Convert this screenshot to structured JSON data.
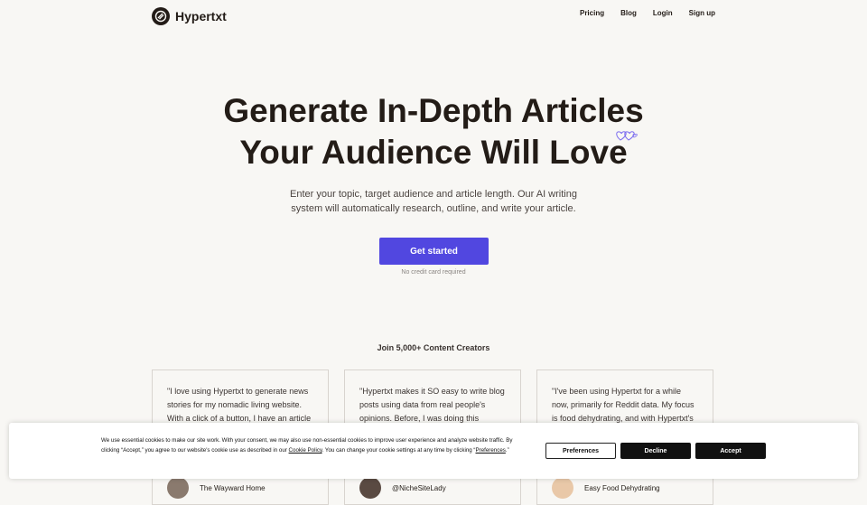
{
  "brand": {
    "name": "Hypertxt"
  },
  "nav": {
    "items": [
      {
        "label": "Pricing"
      },
      {
        "label": "Blog"
      },
      {
        "label": "Login"
      },
      {
        "label": "Sign up"
      }
    ]
  },
  "hero": {
    "title_line1": "Generate In-Depth Articles",
    "title_line2": "Your Audience Will Love",
    "subtitle": "Enter your topic, target audience and article length. Our AI writing system will automatically research, outline, and write your article.",
    "cta_label": "Get started",
    "cta_note": "No credit card required"
  },
  "social": {
    "heading": "Join 5,000+ Content Creators",
    "testimonials": [
      {
        "quote": "\"I love using Hypertxt to generate news stories for my nomadic living website. With a click of a button, I have an article to",
        "author": "The Wayward Home"
      },
      {
        "quote": "\"Hypertxt makes it SO easy to write blog posts using data from real people's opinions. Before, I was doing this manually,",
        "author": "@NicheSiteLady"
      },
      {
        "quote": "\"I've been using Hypertxt for a while now, primarily for Reddit data. My focus is food dehydrating, and with Hypertxt's ability to",
        "author": "Easy Food Dehydrating"
      }
    ]
  },
  "cookie": {
    "text_before_link": "We use essential cookies to make our site work. With your consent, we may also use non-essential cookies to improve user experience and analyze website traffic. By clicking “Accept,” you agree to our website's cookie use as described in our ",
    "policy_link": "Cookie Policy",
    "text_middle": ". You can change your cookie settings at any time by clicking “",
    "preferences_link": "Preferences",
    "text_end": ".”",
    "preferences_button": "Preferences",
    "decline_button": "Decline",
    "accept_button": "Accept"
  },
  "colors": {
    "accent": "#5147e0",
    "text_dark": "#231c17",
    "background": "#f8f7f4",
    "hearts": "#7b6cf0"
  },
  "icons": {
    "logo": "hypertxt-logo-icon",
    "decoration": "hearts-icon"
  }
}
